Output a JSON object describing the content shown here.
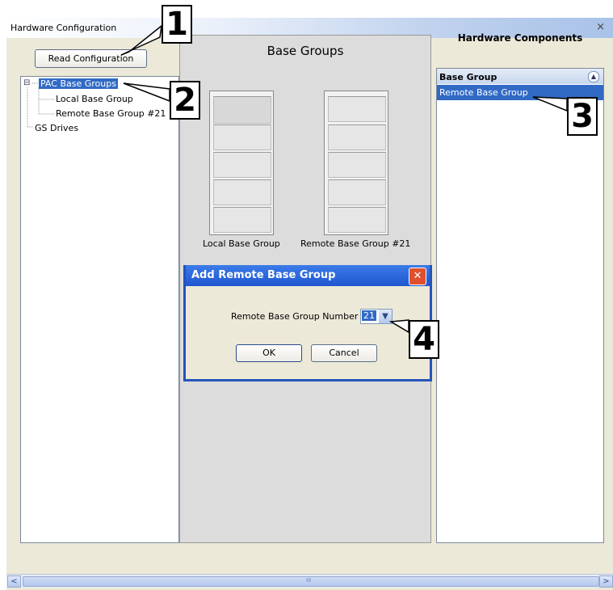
{
  "window": {
    "title": "Hardware Configuration",
    "close_glyph": "×"
  },
  "toolbar": {
    "read_config_label": "Read Configuration"
  },
  "tree": {
    "expander": "⊟",
    "items": [
      {
        "label": "PAC Base Groups"
      },
      {
        "label": "Local Base Group"
      },
      {
        "label": "Remote Base Group #21"
      },
      {
        "label": "GS Drives"
      }
    ]
  },
  "center": {
    "title": "Base Groups",
    "racks": [
      {
        "label": "Local Base Group"
      },
      {
        "label": "Remote Base Group #21"
      }
    ]
  },
  "dialog": {
    "title": "Add Remote Base Group",
    "close_glyph": "✕",
    "field_label": "Remote Base Group Number",
    "field_value": "21",
    "ok_label": "OK",
    "cancel_label": "Cancel"
  },
  "components": {
    "title": "Hardware Components",
    "group_header": "Base Group",
    "items": [
      {
        "label": "Remote Base Group"
      }
    ]
  },
  "callouts": [
    "1",
    "2",
    "3",
    "4"
  ],
  "scrollbar": {
    "left_arrow": "<",
    "right_arrow": ">",
    "thumb_grip": "III"
  },
  "colors": {
    "selection": "#316ac5",
    "dialog_title": "#2553b8",
    "close_red": "#e0502e"
  }
}
